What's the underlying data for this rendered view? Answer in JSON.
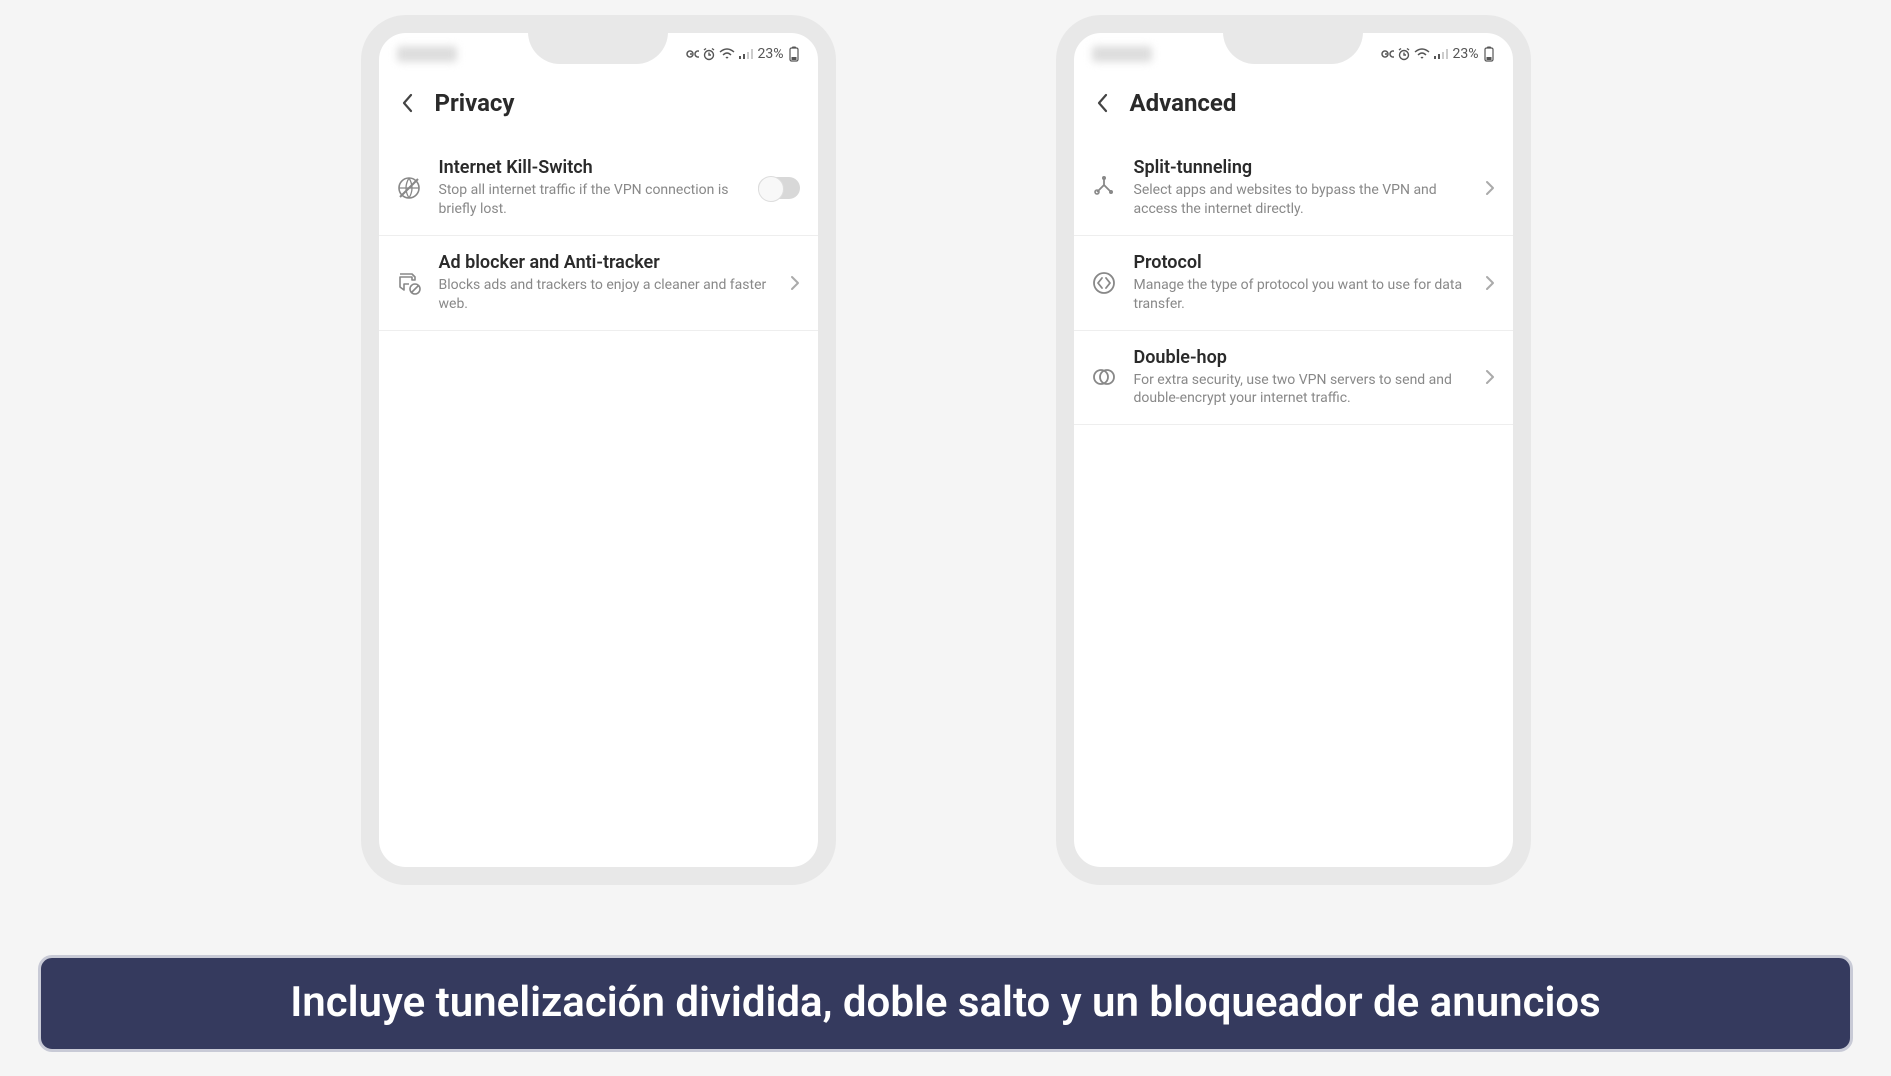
{
  "status_bar": {
    "battery_text": "23%"
  },
  "phone1": {
    "title": "Privacy",
    "items": [
      {
        "title": "Internet Kill-Switch",
        "desc": "Stop all internet traffic if the VPN connection is briefly lost."
      },
      {
        "title": "Ad blocker and Anti-tracker",
        "desc": "Blocks ads and trackers to enjoy a cleaner and faster web."
      }
    ]
  },
  "phone2": {
    "title": "Advanced",
    "items": [
      {
        "title": "Split-tunneling",
        "desc": "Select apps and websites to bypass the VPN and access the internet directly."
      },
      {
        "title": "Protocol",
        "desc": "Manage the type of protocol you want to use for data transfer."
      },
      {
        "title": "Double-hop",
        "desc": "For extra security, use two VPN servers to send and double-encrypt your internet traffic."
      }
    ]
  },
  "caption": "Incluye tunelización dividida, doble salto y un bloqueador de anuncios"
}
